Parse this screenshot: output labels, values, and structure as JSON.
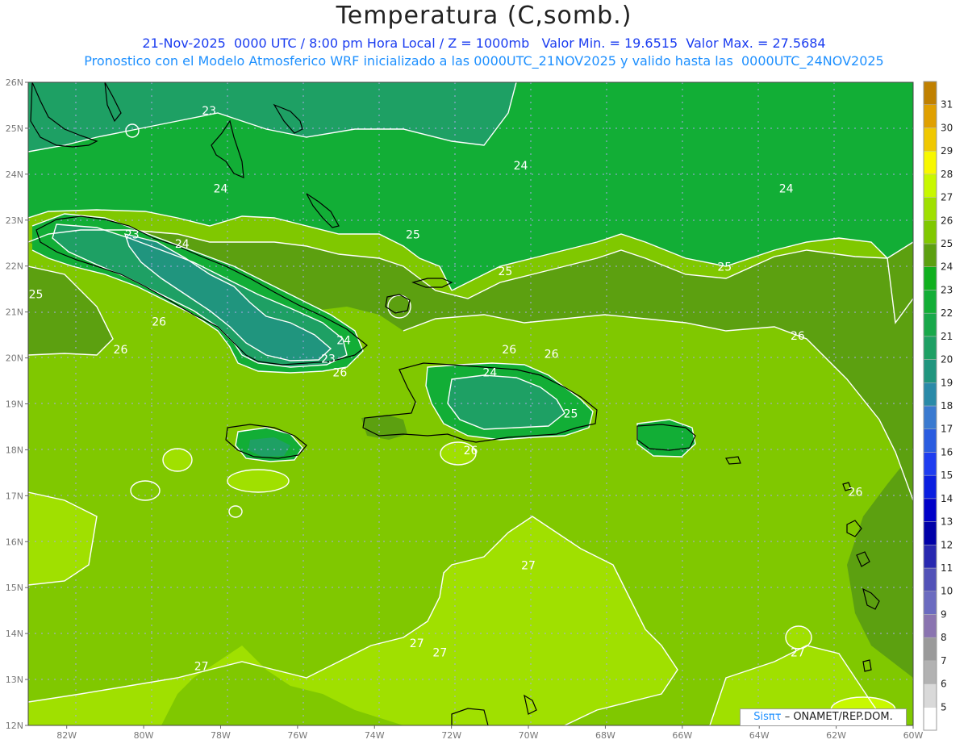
{
  "header": {
    "title": "Temperatura (C,somb.)",
    "subtitle_line1": "21-Nov-2025  0000 UTC / 8:00 pm Hora Local / Z = 1000mb   Valor Min. = 19.6515  Valor Max. = 27.5684",
    "subtitle_line2": "Pronostico con el Modelo Atmosferico WRF inicializado a las 0000UTC_21NOV2025 y valido hasta las  0000UTC_24NOV2025"
  },
  "map": {
    "lon_range": [
      -83,
      -60
    ],
    "lat_range": [
      12,
      26
    ],
    "lon_ticks": [
      "82W",
      "80W",
      "78W",
      "76W",
      "74W",
      "72W",
      "70W",
      "68W",
      "66W",
      "64W",
      "62W",
      "60W"
    ],
    "lat_ticks": [
      "26N",
      "25N",
      "24N",
      "23N",
      "22N",
      "21N",
      "20N",
      "19N",
      "18N",
      "17N",
      "16N",
      "15N",
      "14N",
      "13N",
      "12N"
    ],
    "contour_labels": [
      {
        "text": "23",
        "lon": -78.3,
        "lat": 25.3
      },
      {
        "text": "24",
        "lon": -78.0,
        "lat": 23.6
      },
      {
        "text": "24",
        "lon": -70.2,
        "lat": 24.1
      },
      {
        "text": "24",
        "lon": -63.3,
        "lat": 23.6
      },
      {
        "text": "23",
        "lon": -80.3,
        "lat": 22.6
      },
      {
        "text": "24",
        "lon": -79.0,
        "lat": 22.4
      },
      {
        "text": "25",
        "lon": -73.0,
        "lat": 22.6
      },
      {
        "text": "25",
        "lon": -70.6,
        "lat": 21.8
      },
      {
        "text": "25",
        "lon": -64.9,
        "lat": 21.9
      },
      {
        "text": "25",
        "lon": -82.8,
        "lat": 21.3
      },
      {
        "text": "26",
        "lon": -79.6,
        "lat": 20.7
      },
      {
        "text": "26",
        "lon": -80.6,
        "lat": 20.1
      },
      {
        "text": "24",
        "lon": -74.8,
        "lat": 20.3
      },
      {
        "text": "23",
        "lon": -75.2,
        "lat": 19.9
      },
      {
        "text": "26",
        "lon": -74.9,
        "lat": 19.6
      },
      {
        "text": "26",
        "lon": -70.5,
        "lat": 20.1
      },
      {
        "text": "26",
        "lon": -69.4,
        "lat": 20.0
      },
      {
        "text": "26",
        "lon": -63.0,
        "lat": 20.4
      },
      {
        "text": "24",
        "lon": -71.0,
        "lat": 19.6
      },
      {
        "text": "25",
        "lon": -68.9,
        "lat": 18.7
      },
      {
        "text": "26",
        "lon": -71.5,
        "lat": 17.9
      },
      {
        "text": "26",
        "lon": -61.5,
        "lat": 17.0
      },
      {
        "text": "27",
        "lon": -70.0,
        "lat": 15.4
      },
      {
        "text": "27",
        "lon": -72.9,
        "lat": 13.7
      },
      {
        "text": "27",
        "lon": -72.3,
        "lat": 13.5
      },
      {
        "text": "27",
        "lon": -78.5,
        "lat": 13.2
      },
      {
        "text": "27",
        "lon": -63.0,
        "lat": 13.5
      }
    ]
  },
  "colorbar": {
    "labels": [
      "5",
      "6",
      "7",
      "8",
      "9",
      "10",
      "11",
      "12",
      "13",
      "14",
      "15",
      "16",
      "17",
      "18",
      "19",
      "20",
      "21",
      "22",
      "23",
      "24",
      "25",
      "26",
      "27",
      "28",
      "29",
      "30",
      "31"
    ],
    "colors": [
      "#ffffff",
      "#d9d9d9",
      "#b2b2b2",
      "#9a9a9a",
      "#8a74b0",
      "#6b6bc0",
      "#5252b8",
      "#2828b0",
      "#0000a8",
      "#0000c8",
      "#0a1ee0",
      "#1e3cf0",
      "#2a5ce0",
      "#3a7ad0",
      "#2a8aa8",
      "#20957e",
      "#1ea064",
      "#18a84a",
      "#12ae36",
      "#10b01e",
      "#5ca010",
      "#80c800",
      "#a0e000",
      "#c8f800",
      "#f8f800",
      "#f0c800",
      "#e0a000",
      "#c08000"
    ]
  },
  "credit": {
    "brand": "Sisπτ",
    "org": " – ONAMET/REP.DOM."
  },
  "colors": {
    "background": "#ffffff",
    "temp_22": "#20957e",
    "temp_23": "#1ea064",
    "temp_24": "#12ae36",
    "temp_25": "#5ca010",
    "temp_26": "#80c800",
    "temp_27": "#a0e000",
    "temp_28": "#c8f800",
    "coastline": "#000000",
    "contour": "#ffffff",
    "grid": "#a8a8e8"
  }
}
